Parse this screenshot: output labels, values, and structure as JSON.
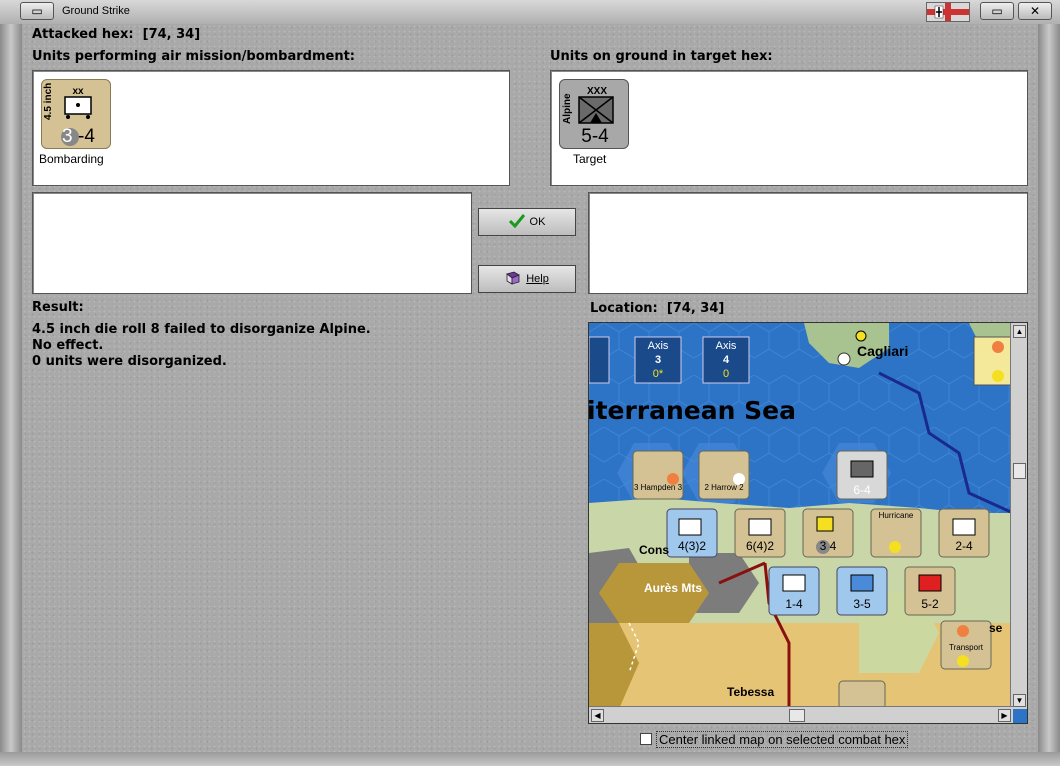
{
  "window": {
    "title": "Ground Strike"
  },
  "header": {
    "attacked_hex_label": "Attacked hex:",
    "attacked_hex_value": "[74, 34]"
  },
  "left_panel": {
    "label": "Units performing air mission/bombardment:",
    "unit": {
      "name": "4.5 inch",
      "size": "xx",
      "strength_left": "3",
      "strength_right": "-4",
      "status": "Bombarding"
    }
  },
  "right_panel": {
    "label": "Units on ground in target hex:",
    "unit": {
      "name": "Alpine",
      "size": "XXX",
      "strength": "5-4",
      "status": "Target"
    }
  },
  "buttons": {
    "ok": "OK",
    "help": "Help"
  },
  "result": {
    "label": "Result:",
    "lines": [
      "4.5 inch die roll 8 failed to disorganize Alpine.",
      "No effect.",
      "0 units were disorganized."
    ]
  },
  "location": {
    "label": "Location:",
    "value": "[74, 34]"
  },
  "map": {
    "sea_label": "iterranean Sea",
    "city_cagliari": "Cagliari",
    "terrain_aures": "Aurès Mts",
    "city_tebessa": "Tebessa",
    "city_cons": "Cons",
    "city_se": "se",
    "axis_boxes": [
      {
        "title": "Axis",
        "num": "3",
        "sub": "0*"
      },
      {
        "title": "Axis",
        "num": "4",
        "sub": "0"
      }
    ],
    "counters": [
      {
        "label": "3 Hampden 3",
        "top": "2",
        "value": "7"
      },
      {
        "label": "2 Harrow 2",
        "top": "0",
        "value": "9"
      },
      {
        "label": "6-4"
      },
      {
        "label": "4(3)2"
      },
      {
        "label": "6(4)2"
      },
      {
        "label": "3 4"
      },
      {
        "label": "Hurricane"
      },
      {
        "label": "2-4"
      },
      {
        "label": "1-4"
      },
      {
        "label": "3-5"
      },
      {
        "label": "5-2"
      },
      {
        "label": "Transport"
      }
    ]
  },
  "footer": {
    "center_map_checkbox": "Center linked map on selected combat hex"
  },
  "colors": {
    "sea": "#2d74c7",
    "counter_tan": "#d4c294",
    "counter_grey": "#a8a8a8",
    "counter_blue": "#9fc8ec",
    "ok_check": "#1a9a1a"
  }
}
